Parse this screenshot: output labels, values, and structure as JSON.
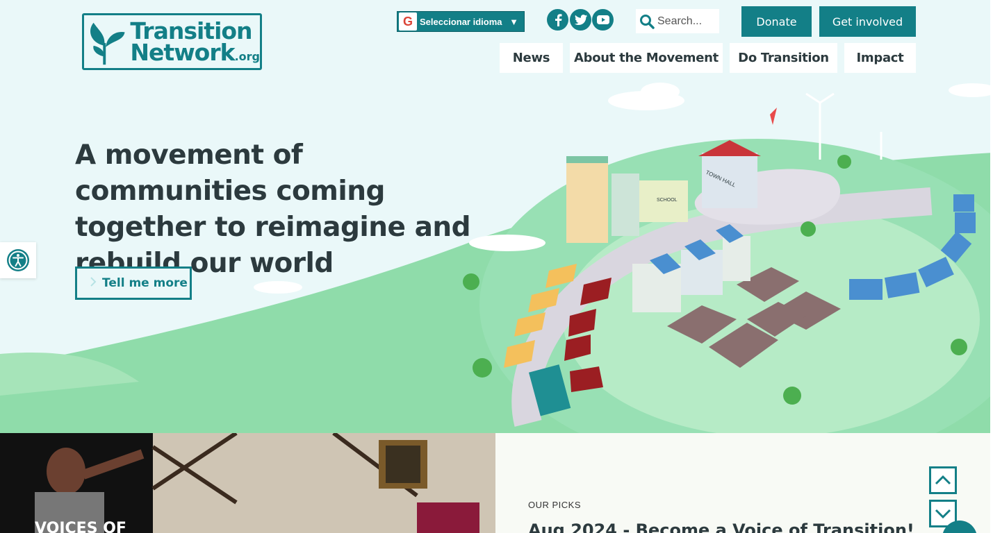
{
  "logo": {
    "line1": "Transition",
    "line2": "Network",
    "suffix": ".org"
  },
  "language": {
    "label": "Seleccionar idioma",
    "caret": "▼"
  },
  "social": [
    {
      "name": "facebook-icon"
    },
    {
      "name": "twitter-icon"
    },
    {
      "name": "youtube-icon"
    }
  ],
  "search": {
    "placeholder": "Search..."
  },
  "header_buttons": {
    "donate": "Donate",
    "involved": "Get involved"
  },
  "nav": {
    "items": [
      "News",
      "About the Movement",
      "Do Transition",
      "Impact"
    ]
  },
  "hero": {
    "headline": "A movement of communities coming together to reimagine and rebuild our world",
    "cta": "Tell me more",
    "illustration_labels": {
      "town_hall": "TOWN HALL",
      "school": "SCHOOL"
    }
  },
  "photo": {
    "overlay": "VOICES OF"
  },
  "picks": {
    "eyebrow": "OUR PICKS",
    "title": "Aug 2024 - Become a Voice of Transition!"
  },
  "colors": {
    "accent": "#137f87",
    "background": "#eaf8f9",
    "text": "#2c3a3e",
    "hill": "#8fdcaa"
  }
}
